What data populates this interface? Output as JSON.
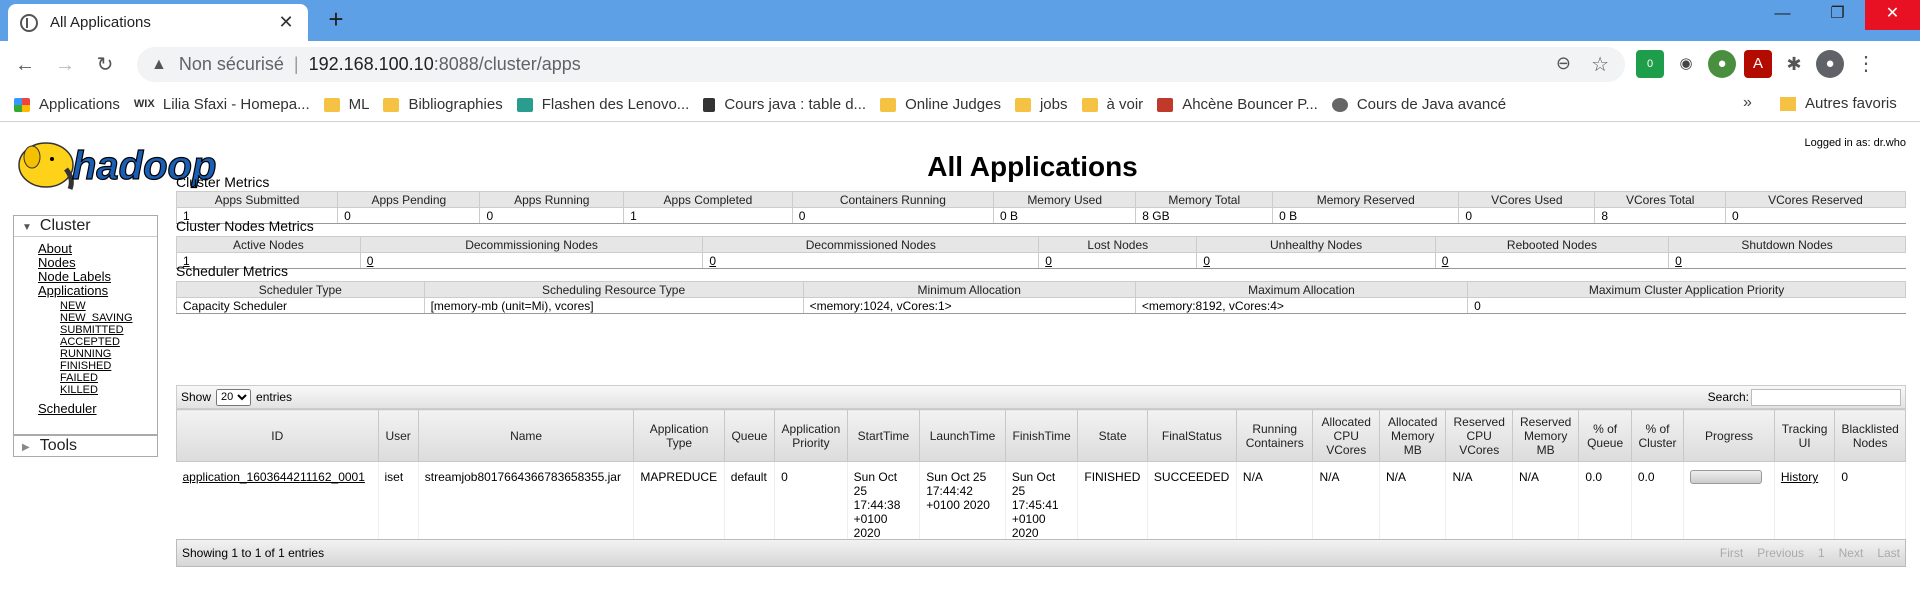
{
  "browser": {
    "tab_title": "All Applications",
    "url_warning": "Non sécurisé",
    "url_host": "192.168.100.10",
    "url_path": ":8088/cluster/apps",
    "bookmarks": [
      {
        "label": "Applications",
        "icon": "apps-grid-icon"
      },
      {
        "label": "Lilia Sfaxi - Homepa...",
        "icon": "wix-icon"
      },
      {
        "label": "ML",
        "icon": "folder-icon"
      },
      {
        "label": "Bibliographies",
        "icon": "folder-icon"
      },
      {
        "label": "Flashen des Lenovo...",
        "icon": "page-icon"
      },
      {
        "label": "Cours java : table d...",
        "icon": "java-icon"
      },
      {
        "label": "Online Judges",
        "icon": "folder-icon"
      },
      {
        "label": "jobs",
        "icon": "folder-icon"
      },
      {
        "label": "à voir",
        "icon": "folder-icon"
      },
      {
        "label": "Ahcène Bouncer P...",
        "icon": "page-icon"
      },
      {
        "label": "Cours de Java avancé",
        "icon": "globe-icon"
      }
    ],
    "bookmarks_more": "»",
    "other_bookmarks": "Autres favoris",
    "badge_count": "0"
  },
  "page": {
    "logo_text": "hadoop",
    "title": "All Applications",
    "logged_in": "Logged in as: dr.who",
    "nav": {
      "cluster_label": "Cluster",
      "items": [
        "About",
        "Nodes",
        "Node Labels",
        "Applications"
      ],
      "app_states": [
        "NEW",
        "NEW_SAVING",
        "SUBMITTED",
        "ACCEPTED",
        "RUNNING",
        "FINISHED",
        "FAILED",
        "KILLED"
      ],
      "scheduler": "Scheduler",
      "tools_label": "Tools"
    },
    "cluster_metrics": {
      "title": "Cluster Metrics",
      "headers": [
        "Apps Submitted",
        "Apps Pending",
        "Apps Running",
        "Apps Completed",
        "Containers Running",
        "Memory Used",
        "Memory Total",
        "Memory Reserved",
        "VCores Used",
        "VCores Total",
        "VCores Reserved"
      ],
      "values": [
        "1",
        "0",
        "0",
        "1",
        "0",
        "0 B",
        "8 GB",
        "0 B",
        "0",
        "8",
        "0"
      ]
    },
    "node_metrics": {
      "title": "Cluster Nodes Metrics",
      "headers": [
        "Active Nodes",
        "Decommissioning Nodes",
        "Decommissioned Nodes",
        "Lost Nodes",
        "Unhealthy Nodes",
        "Rebooted Nodes",
        "Shutdown Nodes"
      ],
      "values": [
        "1",
        "0",
        "0",
        "0",
        "0",
        "0",
        "0"
      ]
    },
    "scheduler_metrics": {
      "title": "Scheduler Metrics",
      "headers": [
        "Scheduler Type",
        "Scheduling Resource Type",
        "Minimum Allocation",
        "Maximum Allocation",
        "Maximum Cluster Application Priority"
      ],
      "values": [
        "Capacity Scheduler",
        "[memory-mb (unit=Mi), vcores]",
        "<memory:1024, vCores:1>",
        "<memory:8192, vCores:4>",
        "0"
      ]
    },
    "table_controls": {
      "show": "Show",
      "entries_value": "20",
      "entries": "entries",
      "search": "Search:"
    },
    "apps_table": {
      "headers": [
        "ID",
        "User",
        "Name",
        "Application Type",
        "Queue",
        "Application Priority",
        "StartTime",
        "LaunchTime",
        "FinishTime",
        "State",
        "FinalStatus",
        "Running Containers",
        "Allocated CPU VCores",
        "Allocated Memory MB",
        "Reserved CPU VCores",
        "Reserved Memory MB",
        "% of Queue",
        "% of Cluster",
        "Progress",
        "Tracking UI",
        "Blacklisted Nodes"
      ],
      "row": {
        "id": "application_1603644211162_0001",
        "user": "iset",
        "name": "streamjob8017664366783658355.jar",
        "type": "MAPREDUCE",
        "queue": "default",
        "priority": "0",
        "start": "Sun Oct 25 17:44:38 +0100 2020",
        "launch": "Sun Oct 25 17:44:42 +0100 2020",
        "finish": "Sun Oct 25 17:45:41 +0100 2020",
        "state": "FINISHED",
        "final_status": "SUCCEEDED",
        "running_containers": "N/A",
        "alloc_vcores": "N/A",
        "alloc_mem": "N/A",
        "res_vcores": "N/A",
        "res_mem": "N/A",
        "pct_queue": "0.0",
        "pct_cluster": "0.0",
        "progress": 0,
        "tracking": "History",
        "blacklisted": "0"
      }
    },
    "footer": {
      "showing": "Showing 1 to 1 of 1 entries",
      "pager": [
        "First",
        "Previous",
        "1",
        "Next",
        "Last"
      ]
    }
  }
}
